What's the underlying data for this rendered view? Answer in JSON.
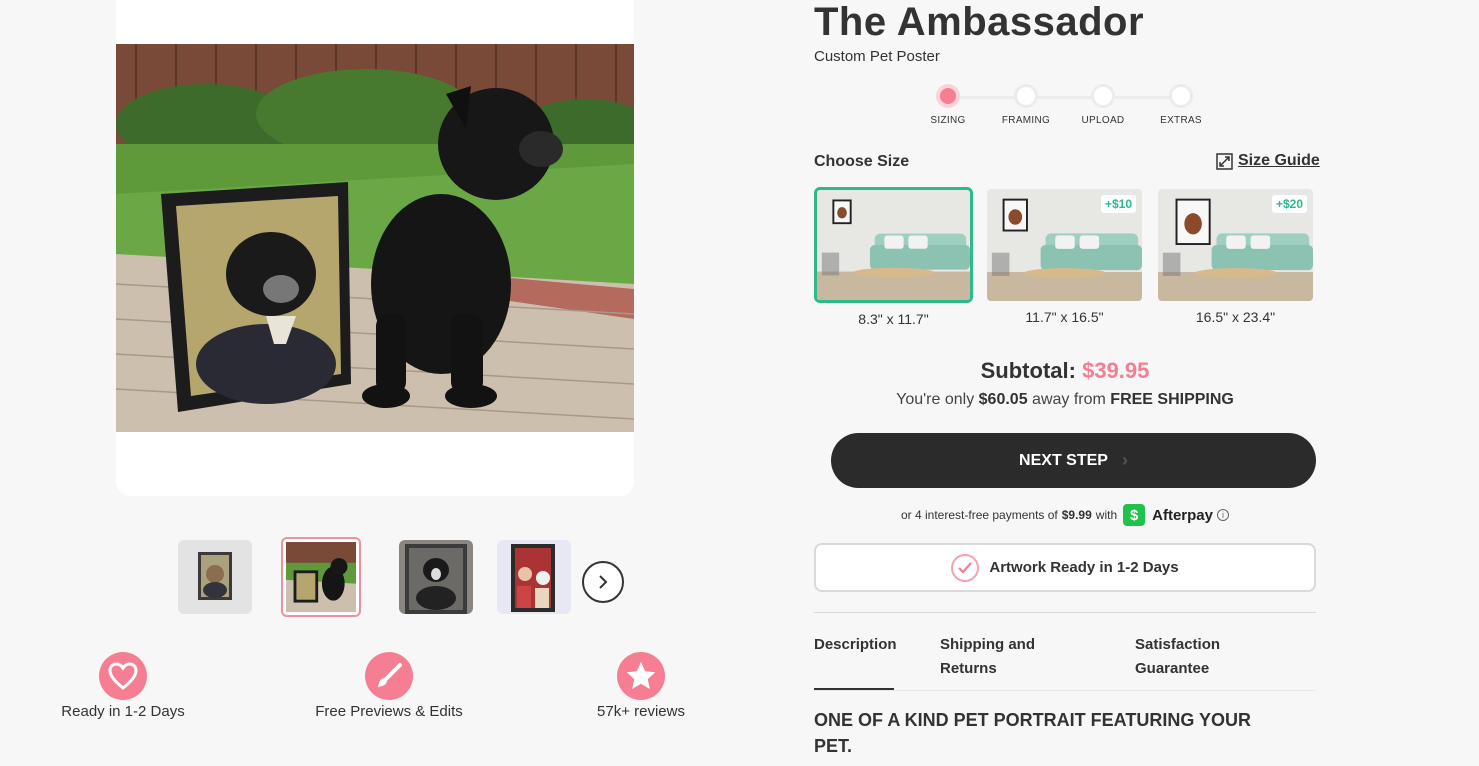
{
  "product": {
    "title": "The Ambassador",
    "subtitle": "Custom Pet Poster"
  },
  "stepper": {
    "steps": [
      {
        "label": "SIZING",
        "active": true
      },
      {
        "label": "FRAMING",
        "active": false
      },
      {
        "label": "UPLOAD",
        "active": false
      },
      {
        "label": "EXTRAS",
        "active": false
      }
    ]
  },
  "size_picker": {
    "heading": "Choose Size",
    "guide_label": "Size Guide",
    "options": [
      {
        "label": "8.3\" x 11.7\"",
        "badge": "",
        "selected": true
      },
      {
        "label": "11.7\" x 16.5\"",
        "badge": "+$10",
        "selected": false
      },
      {
        "label": "16.5\" x 23.4\"",
        "badge": "+$20",
        "selected": false
      }
    ]
  },
  "pricing": {
    "subtotal_label": "Subtotal:",
    "subtotal_amount": "$39.95",
    "shipping_prefix": "You're only",
    "shipping_amount": "$60.05",
    "shipping_mid": "away from",
    "shipping_suffix": "FREE SHIPPING"
  },
  "cta": {
    "next_step": "NEXT STEP"
  },
  "afterpay": {
    "prefix": "or 4 interest-free payments of",
    "amount": "$9.99",
    "with": "with",
    "brand": "Afterpay"
  },
  "badge": {
    "artwork_ready": "Artwork Ready in 1-2 Days"
  },
  "tabs": {
    "description": "Description",
    "shipping_line1": "Shipping and",
    "shipping_line2": "Returns",
    "guarantee_line1": "Satisfaction",
    "guarantee_line2": "Guarantee"
  },
  "description": {
    "heading": "ONE OF A KIND PET PORTRAIT FEATURING YOUR PET."
  },
  "features": [
    {
      "icon": "heart-icon",
      "label": "Ready in 1-2 Days"
    },
    {
      "icon": "brush-icon",
      "label": "Free Previews & Edits"
    },
    {
      "icon": "star-icon",
      "label": "57k+ reviews"
    }
  ],
  "colors": {
    "accent_pink": "#f57e93",
    "selected_green": "#2dba8a",
    "button_dark": "#2c2b2b",
    "afterpay_green": "#1fc24a"
  }
}
